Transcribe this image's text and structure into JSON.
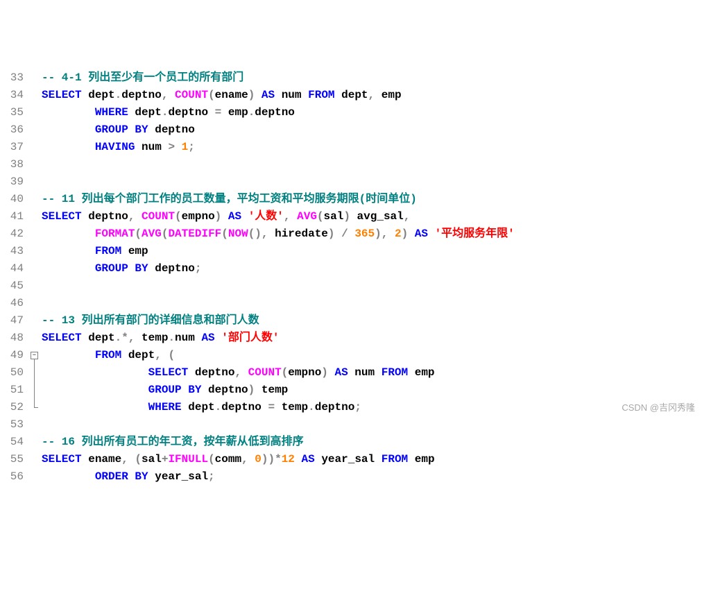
{
  "watermark": "CSDN @吉冈秀隆",
  "gutter": [
    "33",
    "34",
    "35",
    "36",
    "37",
    "38",
    "39",
    "40",
    "41",
    "42",
    "43",
    "44",
    "45",
    "46",
    "47",
    "48",
    "49",
    "50",
    "51",
    "52",
    "53",
    "54",
    "55",
    "56"
  ],
  "fold": {
    "box_symbol": "−",
    "box_row": 16,
    "line_start": 17,
    "line_end": 19
  },
  "lines": [
    [
      [
        "c-comment",
        "-- 4-1 列出至少有一个员工的所有部门"
      ]
    ],
    [
      [
        "c-keyword",
        "SELECT"
      ],
      [
        "c-ident",
        " dept"
      ],
      [
        "c-op",
        "."
      ],
      [
        "c-ident",
        "deptno"
      ],
      [
        "c-op",
        ", "
      ],
      [
        "c-func",
        "COUNT"
      ],
      [
        "c-op",
        "("
      ],
      [
        "c-ident",
        "ename"
      ],
      [
        "c-op",
        ") "
      ],
      [
        "c-keyword",
        "AS"
      ],
      [
        "c-ident",
        " num "
      ],
      [
        "c-keyword",
        "FROM"
      ],
      [
        "c-ident",
        " dept"
      ],
      [
        "c-op",
        ", "
      ],
      [
        "c-ident",
        "emp"
      ]
    ],
    [
      [
        "c-ident",
        "        "
      ],
      [
        "c-keyword",
        "WHERE"
      ],
      [
        "c-ident",
        " dept"
      ],
      [
        "c-op",
        "."
      ],
      [
        "c-ident",
        "deptno "
      ],
      [
        "c-op",
        "="
      ],
      [
        "c-ident",
        " emp"
      ],
      [
        "c-op",
        "."
      ],
      [
        "c-ident",
        "deptno"
      ]
    ],
    [
      [
        "c-ident",
        "        "
      ],
      [
        "c-keyword",
        "GROUP BY"
      ],
      [
        "c-ident",
        " deptno"
      ]
    ],
    [
      [
        "c-ident",
        "        "
      ],
      [
        "c-keyword",
        "HAVING"
      ],
      [
        "c-ident",
        " num "
      ],
      [
        "c-op",
        ">"
      ],
      [
        "c-ident",
        " "
      ],
      [
        "c-num",
        "1"
      ],
      [
        "c-op",
        ";"
      ]
    ],
    [],
    [],
    [
      [
        "c-comment",
        "-- 11 列出每个部门工作的员工数量，平均工资和平均服务期限(时间单位)"
      ]
    ],
    [
      [
        "c-keyword",
        "SELECT"
      ],
      [
        "c-ident",
        " deptno"
      ],
      [
        "c-op",
        ", "
      ],
      [
        "c-func",
        "COUNT"
      ],
      [
        "c-op",
        "("
      ],
      [
        "c-ident",
        "empno"
      ],
      [
        "c-op",
        ") "
      ],
      [
        "c-keyword",
        "AS"
      ],
      [
        "c-ident",
        " "
      ],
      [
        "c-str",
        "'人数'"
      ],
      [
        "c-op",
        ", "
      ],
      [
        "c-func",
        "AVG"
      ],
      [
        "c-op",
        "("
      ],
      [
        "c-ident",
        "sal"
      ],
      [
        "c-op",
        ") "
      ],
      [
        "c-ident",
        "avg_sal"
      ],
      [
        "c-op",
        ","
      ]
    ],
    [
      [
        "c-ident",
        "        "
      ],
      [
        "c-func",
        "FORMAT"
      ],
      [
        "c-op",
        "("
      ],
      [
        "c-func",
        "AVG"
      ],
      [
        "c-op",
        "("
      ],
      [
        "c-func",
        "DATEDIFF"
      ],
      [
        "c-op",
        "("
      ],
      [
        "c-func",
        "NOW"
      ],
      [
        "c-op",
        "(), "
      ],
      [
        "c-ident",
        "hiredate"
      ],
      [
        "c-op",
        ") "
      ],
      [
        "c-op",
        "/"
      ],
      [
        "c-ident",
        " "
      ],
      [
        "c-num",
        "365"
      ],
      [
        "c-op",
        "), "
      ],
      [
        "c-num",
        "2"
      ],
      [
        "c-op",
        ") "
      ],
      [
        "c-keyword",
        "AS"
      ],
      [
        "c-ident",
        " "
      ],
      [
        "c-str",
        "'平均服务年限'"
      ]
    ],
    [
      [
        "c-ident",
        "        "
      ],
      [
        "c-keyword",
        "FROM"
      ],
      [
        "c-ident",
        " emp"
      ]
    ],
    [
      [
        "c-ident",
        "        "
      ],
      [
        "c-keyword",
        "GROUP BY"
      ],
      [
        "c-ident",
        " deptno"
      ],
      [
        "c-op",
        ";"
      ]
    ],
    [],
    [],
    [
      [
        "c-comment",
        "-- 13 列出所有部门的详细信息和部门人数"
      ]
    ],
    [
      [
        "c-keyword",
        "SELECT"
      ],
      [
        "c-ident",
        " dept"
      ],
      [
        "c-op",
        ".*, "
      ],
      [
        "c-ident",
        "temp"
      ],
      [
        "c-op",
        "."
      ],
      [
        "c-ident",
        "num "
      ],
      [
        "c-keyword",
        "AS"
      ],
      [
        "c-ident",
        " "
      ],
      [
        "c-str",
        "'部门人数'"
      ]
    ],
    [
      [
        "c-ident",
        "        "
      ],
      [
        "c-keyword",
        "FROM"
      ],
      [
        "c-ident",
        " dept"
      ],
      [
        "c-op",
        ", ("
      ]
    ],
    [
      [
        "c-ident",
        "                "
      ],
      [
        "c-keyword",
        "SELECT"
      ],
      [
        "c-ident",
        " deptno"
      ],
      [
        "c-op",
        ", "
      ],
      [
        "c-func",
        "COUNT"
      ],
      [
        "c-op",
        "("
      ],
      [
        "c-ident",
        "empno"
      ],
      [
        "c-op",
        ") "
      ],
      [
        "c-keyword",
        "AS"
      ],
      [
        "c-ident",
        " num "
      ],
      [
        "c-keyword",
        "FROM"
      ],
      [
        "c-ident",
        " emp"
      ]
    ],
    [
      [
        "c-ident",
        "                "
      ],
      [
        "c-keyword",
        "GROUP BY"
      ],
      [
        "c-ident",
        " deptno"
      ],
      [
        "c-op",
        ") "
      ],
      [
        "c-ident",
        "temp"
      ]
    ],
    [
      [
        "c-ident",
        "                "
      ],
      [
        "c-keyword",
        "WHERE"
      ],
      [
        "c-ident",
        " dept"
      ],
      [
        "c-op",
        "."
      ],
      [
        "c-ident",
        "deptno "
      ],
      [
        "c-op",
        "="
      ],
      [
        "c-ident",
        " temp"
      ],
      [
        "c-op",
        "."
      ],
      [
        "c-ident",
        "deptno"
      ],
      [
        "c-op",
        ";"
      ]
    ],
    [],
    [
      [
        "c-comment",
        "-- 16 列出所有员工的年工资，按年薪从低到高排序"
      ]
    ],
    [
      [
        "c-keyword",
        "SELECT"
      ],
      [
        "c-ident",
        " ename"
      ],
      [
        "c-op",
        ", ("
      ],
      [
        "c-ident",
        "sal"
      ],
      [
        "c-op",
        "+"
      ],
      [
        "c-func",
        "IFNULL"
      ],
      [
        "c-op",
        "("
      ],
      [
        "c-ident",
        "comm"
      ],
      [
        "c-op",
        ", "
      ],
      [
        "c-num",
        "0"
      ],
      [
        "c-op",
        "))*"
      ],
      [
        "c-num",
        "12"
      ],
      [
        "c-ident",
        " "
      ],
      [
        "c-keyword",
        "AS"
      ],
      [
        "c-ident",
        " year_sal "
      ],
      [
        "c-keyword",
        "FROM"
      ],
      [
        "c-ident",
        " emp"
      ]
    ],
    [
      [
        "c-ident",
        "        "
      ],
      [
        "c-keyword",
        "ORDER BY"
      ],
      [
        "c-ident",
        " year_sal"
      ],
      [
        "c-op",
        ";"
      ]
    ]
  ]
}
